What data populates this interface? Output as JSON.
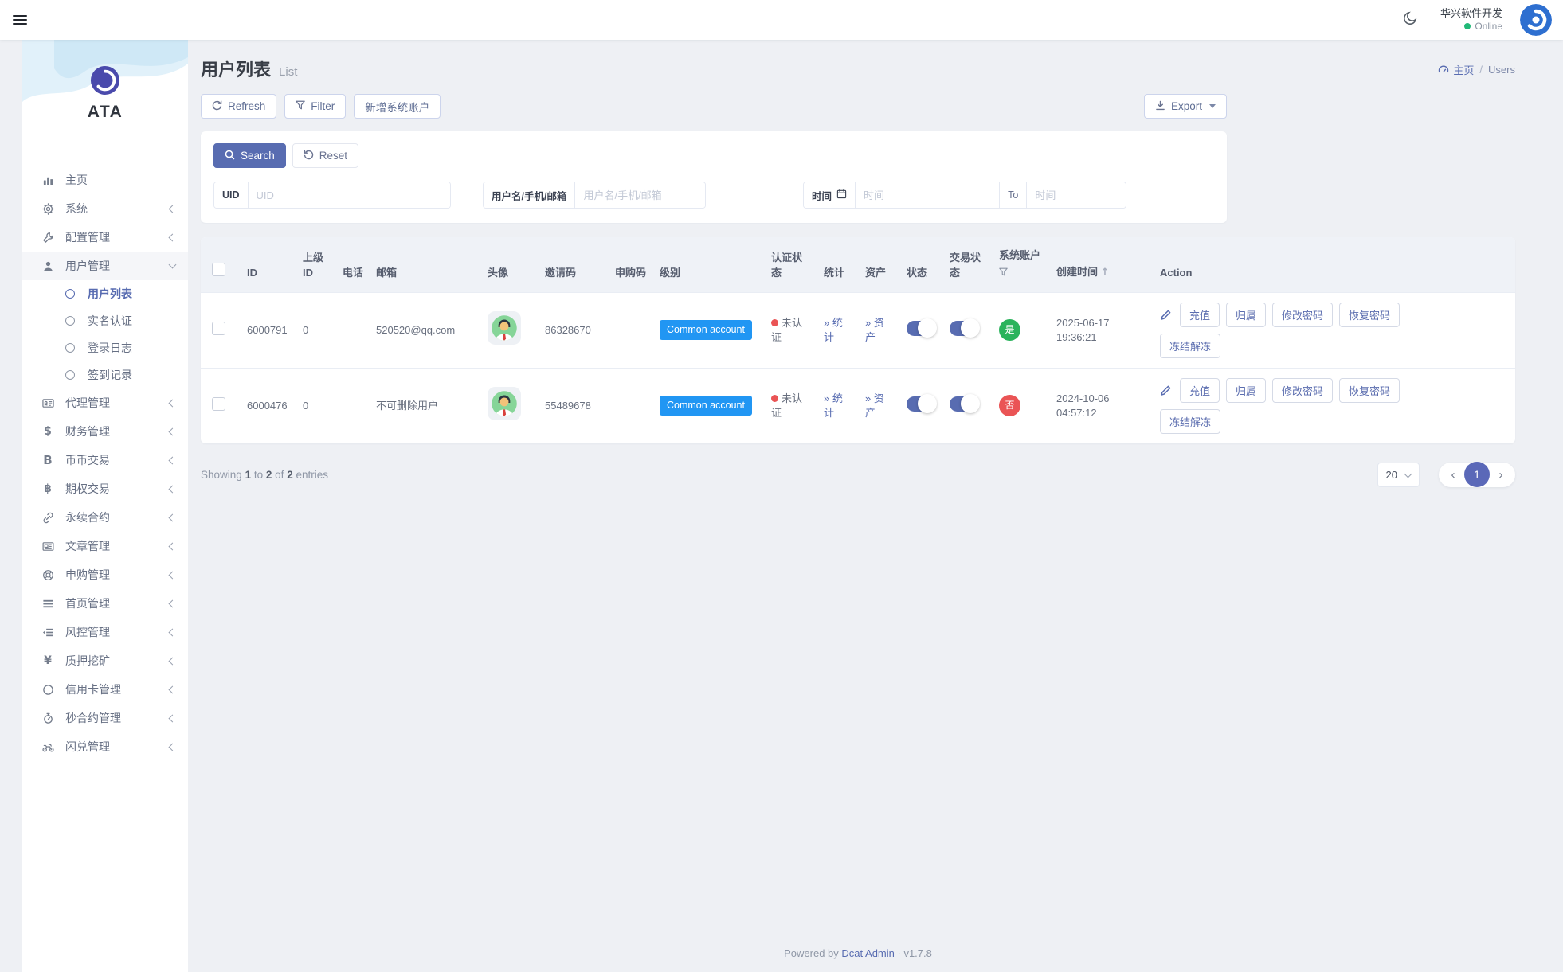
{
  "topbar": {
    "user_name": "华兴软件开发",
    "status": "Online"
  },
  "sidebar": {
    "logo_text": "ATA",
    "items": [
      {
        "label": "主页",
        "icon": "chart-bar-icon"
      },
      {
        "label": "系统",
        "icon": "gear-icon"
      },
      {
        "label": "配置管理",
        "icon": "wrench-icon"
      },
      {
        "label": "用户管理",
        "icon": "user-icon",
        "children": [
          {
            "label": "用户列表",
            "active": true
          },
          {
            "label": "实名认证"
          },
          {
            "label": "登录日志"
          },
          {
            "label": "签到记录"
          }
        ]
      },
      {
        "label": "代理管理",
        "icon": "id-card-icon"
      },
      {
        "label": "财务管理",
        "icon": "dollar-icon",
        "glyph": "$"
      },
      {
        "label": "币币交易",
        "icon": "btc-b-icon",
        "glyph": "B"
      },
      {
        "label": "期权交易",
        "icon": "baht-icon",
        "glyph": "฿"
      },
      {
        "label": "永续合约",
        "icon": "link-icon"
      },
      {
        "label": "文章管理",
        "icon": "newspaper-icon"
      },
      {
        "label": "申购管理",
        "icon": "life-ring-icon"
      },
      {
        "label": "首页管理",
        "icon": "list-icon"
      },
      {
        "label": "风控管理",
        "icon": "outdent-icon"
      },
      {
        "label": "质押挖矿",
        "icon": "yen-icon",
        "glyph": "¥"
      },
      {
        "label": "信用卡管理",
        "icon": "circle-icon"
      },
      {
        "label": "秒合约管理",
        "icon": "stopwatch-icon"
      },
      {
        "label": "闪兑管理",
        "icon": "motorcycle-icon"
      }
    ]
  },
  "page": {
    "title": "用户列表",
    "subtitle": "List",
    "breadcrumb": {
      "home": "主页",
      "sep": "/",
      "current": "Users"
    }
  },
  "toolbar": {
    "refresh": "Refresh",
    "filter": "Filter",
    "add_system_account": "新增系统账户",
    "export": "Export"
  },
  "search_panel": {
    "search": "Search",
    "reset": "Reset",
    "uid_label": "UID",
    "uid_placeholder": "UID",
    "user_label": "用户名/手机/邮箱",
    "user_placeholder": "用户名/手机/邮箱",
    "time_label": "时间",
    "time_from_placeholder": "时间",
    "to_label": "To",
    "time_to_placeholder": "时间"
  },
  "table": {
    "headers": [
      "ID",
      "上级ID",
      "电话",
      "邮箱",
      "头像",
      "邀请码",
      "申购码",
      "级别",
      "认证状态",
      "统计",
      "资产",
      "状态",
      "交易状态",
      "系统账户",
      "创建时间",
      "Action"
    ],
    "sort_arrow": "↑",
    "rows": [
      {
        "id": "6000791",
        "parent_id": "0",
        "email": "520520@qq.com",
        "invite_code": "86328670",
        "level": "Common account",
        "auth_status": "未认证",
        "stats_label": "» 统计",
        "assets_label": "» 资产",
        "system_account": "是",
        "created_date": "2025-06-17",
        "created_time": "19:36:21"
      },
      {
        "id": "6000476",
        "parent_id": "0",
        "email": "不可删除用户",
        "invite_code": "55489678",
        "level": "Common account",
        "auth_status": "未认证",
        "stats_label": "» 统计",
        "assets_label": "» 资产",
        "system_account": "否",
        "created_date": "2024-10-06",
        "created_time": "04:57:12"
      }
    ],
    "actions": [
      "充值",
      "归属",
      "修改密码",
      "恢复密码",
      "冻结解冻"
    ],
    "summary": {
      "t1": "Showing",
      "n1": "1",
      "t2": "to",
      "n2": "2",
      "t3": "of",
      "n3": "2",
      "t4": "entries"
    },
    "pagination": {
      "page_size": "20",
      "page": "1",
      "prev": "‹",
      "next": "›"
    }
  },
  "footer": {
    "powered": "Powered by",
    "brand": "Dcat Admin",
    "version": "· v1.7.8"
  }
}
